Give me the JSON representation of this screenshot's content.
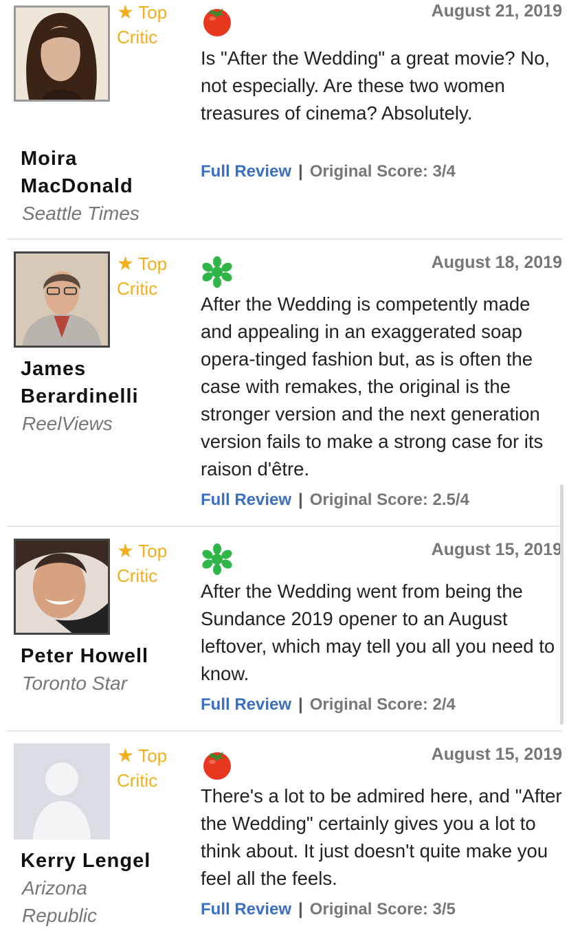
{
  "reviews": [
    {
      "critic": "Moira MacDonald",
      "critic_lines": [
        "Moira",
        "MacDonald"
      ],
      "publication_lines": [
        "Seattle Times"
      ],
      "top_critic_lines": [
        "Top",
        "Critic"
      ],
      "score_icon": "fresh-tomato-icon",
      "date": "August 21, 2019",
      "quote": "Is \"After the Wedding\" a great movie? No, not especially. Are these two women treasures of cinema? Absolutely.",
      "full_review": "Full Review",
      "separator": "|",
      "original_score": "Original Score: 3/4"
    },
    {
      "critic": "James Berardinelli",
      "critic_lines": [
        "James",
        "Berardinelli"
      ],
      "publication_lines": [
        "ReelViews"
      ],
      "top_critic_lines": [
        "Top",
        "Critic"
      ],
      "score_icon": "rotten-splat-icon",
      "date": "August 18, 2019",
      "quote": "After the Wedding is competently made and appealing in an exaggerated soap opera-tinged fashion but, as is often the case with remakes, the original is the stronger version and the next generation version fails to make a strong case for its raison d'être.",
      "full_review": "Full Review",
      "separator": "|",
      "original_score": "Original Score: 2.5/4"
    },
    {
      "critic": "Peter Howell",
      "critic_lines": [
        "Peter Howell"
      ],
      "publication_lines": [
        "Toronto Star"
      ],
      "top_critic_lines": [
        "Top",
        "Critic"
      ],
      "score_icon": "rotten-splat-icon",
      "date": "August 15, 2019",
      "quote": "After the Wedding went from being the Sundance 2019 opener to an August leftover, which may tell you all you need to know.",
      "full_review": "Full Review",
      "separator": "|",
      "original_score": "Original Score: 2/4"
    },
    {
      "critic": "Kerry Lengel",
      "critic_lines": [
        "Kerry Lengel"
      ],
      "publication_lines": [
        "Arizona",
        "Republic"
      ],
      "top_critic_lines": [
        "Top",
        "Critic"
      ],
      "score_icon": "fresh-tomato-icon",
      "date": "August 15, 2019",
      "quote": "There's a lot to be admired here, and \"After the Wedding\" certainly gives you a lot to think about. It just doesn't quite make you feel all the feels.",
      "full_review": "Full Review",
      "separator": "|",
      "original_score": "Original Score: 3/5"
    }
  ],
  "colors": {
    "top_critic": "#f2b01e",
    "link": "#3a6fc1",
    "fresh": "#e8371f",
    "rotten": "#2fb548",
    "muted": "#777777"
  }
}
